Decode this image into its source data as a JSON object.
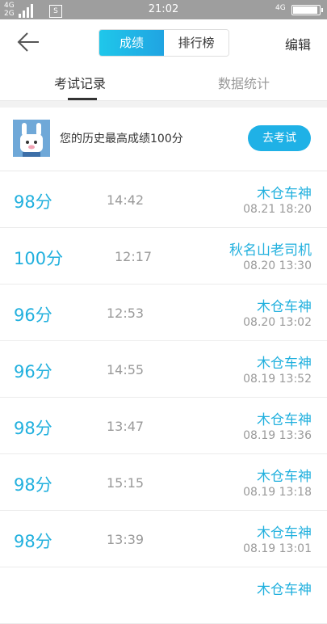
{
  "status_bar": {
    "network_top": "4G",
    "network_bottom": "2G",
    "sim_icon": "sim-card-icon",
    "time": "21:02",
    "network_right": "4G",
    "battery_level": 0.95
  },
  "header": {
    "back_icon": "back-arrow-icon",
    "segments": [
      "成绩",
      "排行榜"
    ],
    "active_segment": 0,
    "edit_label": "编辑"
  },
  "tabs": {
    "items": [
      "考试记录",
      "数据统计"
    ],
    "active": 0
  },
  "best": {
    "avatar_icon": "robot-avatar-icon",
    "text": "您的历史最高成绩100分",
    "button_label": "去考试"
  },
  "records": [
    {
      "score": "98分",
      "duration": "14:42",
      "name": "木仓车神",
      "datetime": "08.21  18:20"
    },
    {
      "score": "100分",
      "duration": "12:17",
      "name": "秋名山老司机",
      "datetime": "08.20  13:30"
    },
    {
      "score": "96分",
      "duration": "12:53",
      "name": "木仓车神",
      "datetime": "08.20  13:02"
    },
    {
      "score": "96分",
      "duration": "14:55",
      "name": "木仓车神",
      "datetime": "08.19  13:52"
    },
    {
      "score": "98分",
      "duration": "13:47",
      "name": "木仓车神",
      "datetime": "08.19  13:36"
    },
    {
      "score": "98分",
      "duration": "15:15",
      "name": "木仓车神",
      "datetime": "08.19  13:18"
    },
    {
      "score": "98分",
      "duration": "13:39",
      "name": "木仓车神",
      "datetime": "08.19  13:01"
    },
    {
      "score": "",
      "duration": "",
      "name": "木仓车神",
      "datetime": ""
    }
  ],
  "colors": {
    "accent": "#21b0de",
    "button": "#1fb1e6",
    "muted": "#9a9a9a",
    "status_bar": "#9e9e9e"
  }
}
